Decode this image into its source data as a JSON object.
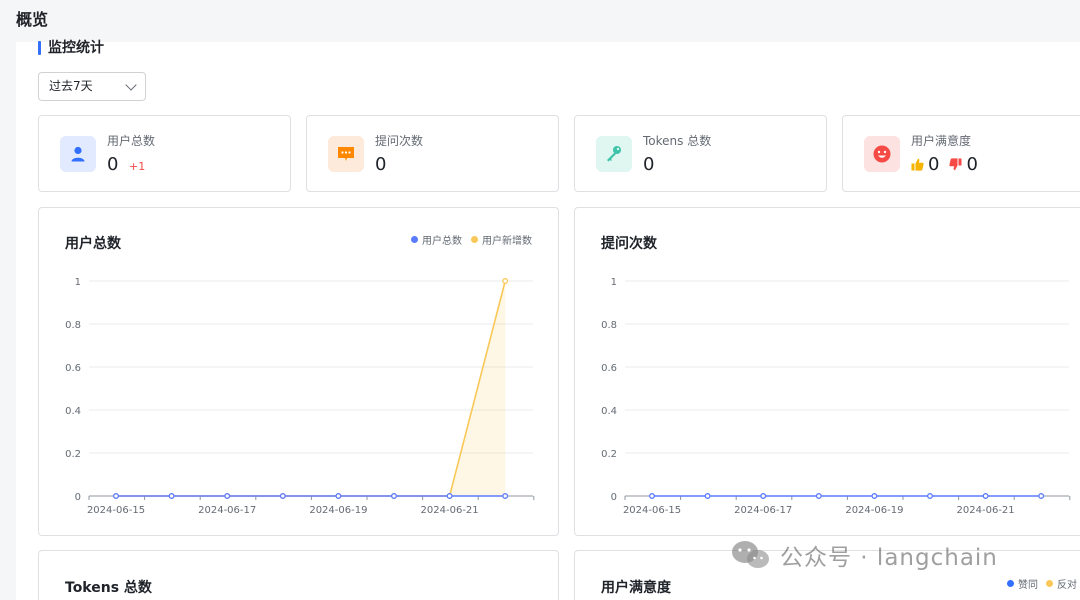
{
  "page": {
    "title": "概览"
  },
  "section": {
    "title": "监控统计"
  },
  "range_select": {
    "value": "过去7天"
  },
  "stats": [
    {
      "label": "用户总数",
      "value": "0",
      "delta": "+1",
      "icon": "user-icon",
      "color": "#3370ff",
      "bg": "#e1eaff"
    },
    {
      "label": "提问次数",
      "value": "0",
      "icon": "message-icon",
      "color": "#ff8800",
      "bg": "#feeadb"
    },
    {
      "label": "Tokens 总数",
      "value": "0",
      "icon": "key-icon",
      "color": "#3dc3a8",
      "bg": "#dff6f1"
    },
    {
      "label": "用户满意度",
      "like": "0",
      "dislike": "0",
      "icon": "smile-icon",
      "color": "#f54a45",
      "bg": "#fde2e2"
    }
  ],
  "bottom_cards": [
    {
      "title": "Tokens 总数"
    },
    {
      "title": "用户满意度",
      "legend": [
        "赞同",
        "反对"
      ],
      "legend_colors": [
        "#3370ff",
        "#fac858"
      ]
    }
  ],
  "watermark": {
    "text": "公众号 · langchain"
  },
  "chart_data": [
    {
      "type": "line",
      "title": "用户总数",
      "x": [
        "2024-06-15",
        "2024-06-16",
        "2024-06-17",
        "2024-06-18",
        "2024-06-19",
        "2024-06-20",
        "2024-06-21",
        "2024-06-22"
      ],
      "x_tick_labels": [
        "2024-06-15",
        "2024-06-17",
        "2024-06-19",
        "2024-06-21"
      ],
      "y_ticks": [
        "1",
        "0.8",
        "0.6",
        "0.4",
        "0.2",
        "0"
      ],
      "ylim": [
        0,
        1
      ],
      "grid": true,
      "legend_position": "top-right",
      "series": [
        {
          "name": "用户总数",
          "color": "#5b7bff",
          "values": [
            0,
            0,
            0,
            0,
            0,
            0,
            0,
            0
          ]
        },
        {
          "name": "用户新增数",
          "color": "#fac858",
          "area": true,
          "values": [
            0,
            0,
            0,
            0,
            0,
            0,
            0,
            1
          ]
        }
      ]
    },
    {
      "type": "line",
      "title": "提问次数",
      "x": [
        "2024-06-15",
        "2024-06-16",
        "2024-06-17",
        "2024-06-18",
        "2024-06-19",
        "2024-06-20",
        "2024-06-21",
        "2024-06-22"
      ],
      "x_tick_labels": [
        "2024-06-15",
        "2024-06-17",
        "2024-06-19",
        "2024-06-21"
      ],
      "y_ticks": [
        "1",
        "0.8",
        "0.6",
        "0.4",
        "0.2",
        "0"
      ],
      "ylim": [
        0,
        1
      ],
      "grid": true,
      "series": [
        {
          "color": "#5b7bff",
          "values": [
            0,
            0,
            0,
            0,
            0,
            0,
            0,
            0
          ]
        }
      ]
    }
  ]
}
